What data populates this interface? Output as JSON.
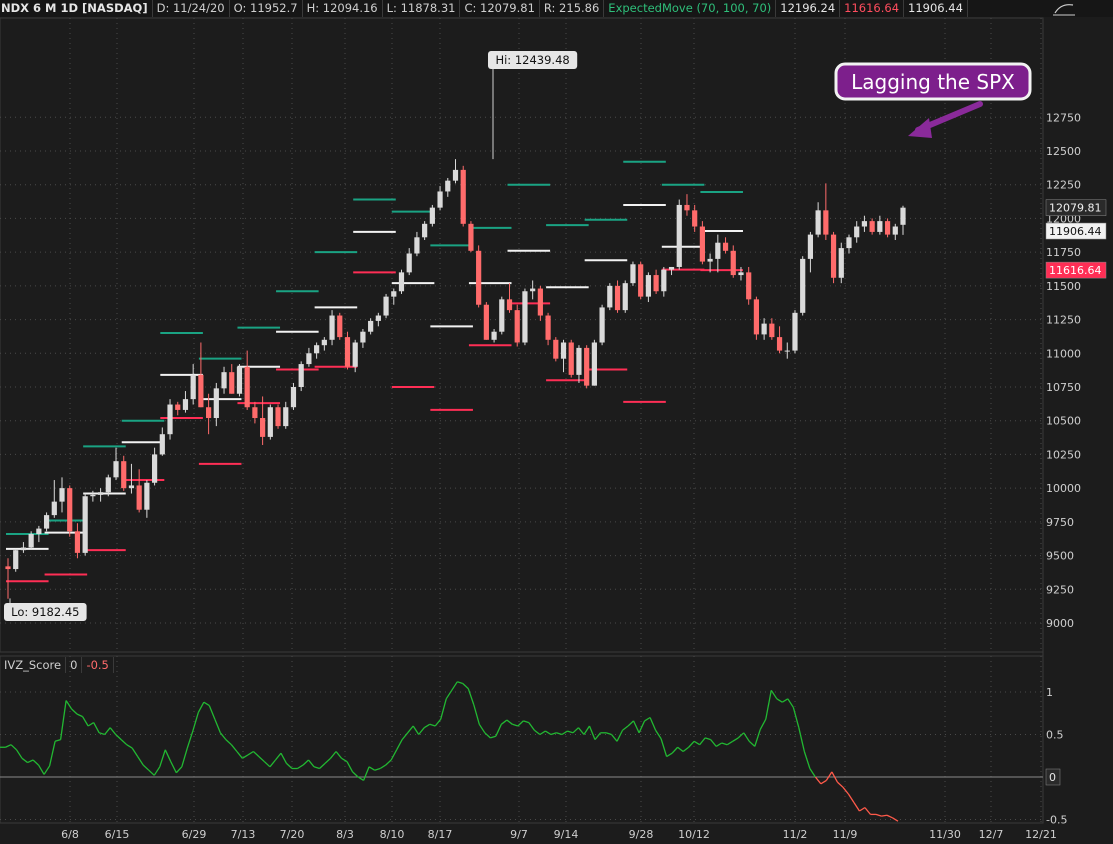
{
  "header": {
    "title": "NDX 6 M 1D [NASDAQ]",
    "date": "D: 11/24/20",
    "open": "O: 11952.7",
    "high": "H: 12094.16",
    "low": "L: 11878.31",
    "close": "C: 12079.81",
    "range": "R: 215.86",
    "study": "ExpectedMove (70, 100, 70)",
    "em_upper": "12196.24",
    "em_lower": "11616.64",
    "em_mid": "11906.44"
  },
  "lower_header": {
    "name": "IVZ_Score",
    "v1": "0",
    "v2": "-0.5"
  },
  "annotation": {
    "text": "Lagging the SPX"
  },
  "colors": {
    "background": "#1c1c1c",
    "up": "#dadada",
    "down": "#ff6b6b",
    "em_upper": "#1aa383",
    "em_lower": "#ff2e55",
    "em_mid": "#f2f2f2",
    "ivz_pos": "#22b832",
    "ivz_neg": "#ff5a4a",
    "annotation": "#7d1f8c"
  },
  "chart_data": [
    {
      "type": "candlestick",
      "title": "NDX 6 M 1D [NASDAQ]",
      "ylim": [
        8850,
        12800
      ],
      "y_ticks": [
        9000,
        9250,
        9500,
        9750,
        10000,
        10250,
        10500,
        10750,
        11000,
        11250,
        11500,
        11750,
        12000,
        12250,
        12500,
        12750
      ],
      "x_ticks": [
        "6/8",
        "6/15",
        "6/29",
        "7/13",
        "7/20",
        "8/3",
        "8/10",
        "8/17",
        "9/7",
        "9/14",
        "9/28",
        "10/12",
        "11/2",
        "11/9",
        "11/30",
        "12/7",
        "12/21"
      ],
      "price_labels": {
        "last": "12079.81",
        "mid": "11906.44",
        "lower": "11616.64"
      },
      "hi_label": {
        "text": "Hi: 12439.48",
        "value": 12439.48
      },
      "lo_label": {
        "text": "Lo: 9182.45",
        "value": 9182.45
      },
      "candles": [
        [
          9420,
          9480,
          9180,
          9400
        ],
        [
          9400,
          9550,
          9380,
          9540
        ],
        [
          9540,
          9600,
          9520,
          9560
        ],
        [
          9560,
          9680,
          9550,
          9660
        ],
        [
          9660,
          9720,
          9600,
          9700
        ],
        [
          9700,
          9820,
          9680,
          9800
        ],
        [
          9800,
          10060,
          9780,
          9900
        ],
        [
          9900,
          10080,
          9820,
          10000
        ],
        [
          10000,
          10020,
          9640,
          9680
        ],
        [
          9680,
          9740,
          9480,
          9520
        ],
        [
          9520,
          9960,
          9500,
          9940
        ],
        [
          9940,
          9980,
          9900,
          9950
        ],
        [
          9950,
          10000,
          9900,
          9970
        ],
        [
          9970,
          10100,
          9940,
          10080
        ],
        [
          10080,
          10300,
          10060,
          10200
        ],
        [
          10200,
          10240,
          9980,
          10000
        ],
        [
          10000,
          10180,
          9960,
          10020
        ],
        [
          10020,
          10140,
          9820,
          9840
        ],
        [
          9840,
          10060,
          9780,
          10040
        ],
        [
          10040,
          10300,
          10020,
          10250
        ],
        [
          10250,
          10450,
          10240,
          10400
        ],
        [
          10400,
          10660,
          10360,
          10620
        ],
        [
          10620,
          10640,
          10540,
          10580
        ],
        [
          10580,
          10720,
          10560,
          10660
        ],
        [
          10660,
          10920,
          10620,
          10840
        ],
        [
          10840,
          11080,
          10600,
          10600
        ],
        [
          10600,
          10700,
          10400,
          10520
        ],
        [
          10520,
          10780,
          10460,
          10740
        ],
        [
          10740,
          10900,
          10700,
          10860
        ],
        [
          10860,
          10920,
          10700,
          10700
        ],
        [
          10700,
          10920,
          10680,
          10900
        ],
        [
          10900,
          11020,
          10580,
          10600
        ],
        [
          10600,
          10640,
          10480,
          10520
        ],
        [
          10520,
          10680,
          10320,
          10380
        ],
        [
          10380,
          10620,
          10360,
          10600
        ],
        [
          10600,
          10620,
          10440,
          10460
        ],
        [
          10460,
          10640,
          10440,
          10600
        ],
        [
          10600,
          10780,
          10580,
          10750
        ],
        [
          10750,
          10940,
          10720,
          10920
        ],
        [
          10920,
          11040,
          10900,
          11000
        ],
        [
          11000,
          11080,
          10960,
          11060
        ],
        [
          11060,
          11120,
          11020,
          11100
        ],
        [
          11100,
          11320,
          11060,
          11280
        ],
        [
          11280,
          11300,
          11100,
          11120
        ],
        [
          11120,
          11160,
          10880,
          10900
        ],
        [
          10900,
          11100,
          10860,
          11080
        ],
        [
          11080,
          11180,
          11040,
          11160
        ],
        [
          11160,
          11260,
          11140,
          11240
        ],
        [
          11240,
          11300,
          11200,
          11280
        ],
        [
          11280,
          11440,
          11260,
          11420
        ],
        [
          11420,
          11480,
          11360,
          11460
        ],
        [
          11460,
          11620,
          11440,
          11600
        ],
        [
          11600,
          11780,
          11580,
          11740
        ],
        [
          11740,
          11900,
          11720,
          11860
        ],
        [
          11860,
          11980,
          11840,
          11960
        ],
        [
          11960,
          12100,
          11940,
          12080
        ],
        [
          12080,
          12240,
          12060,
          12200
        ],
        [
          12200,
          12300,
          12160,
          12280
        ],
        [
          12280,
          12440,
          12260,
          12360
        ],
        [
          12360,
          12390,
          11940,
          11960
        ],
        [
          11960,
          11980,
          11750,
          11760
        ],
        [
          11760,
          11800,
          11340,
          11360
        ],
        [
          11360,
          11380,
          11100,
          11100
        ],
        [
          11100,
          11180,
          11080,
          11160
        ],
        [
          11160,
          11420,
          11140,
          11400
        ],
        [
          11400,
          11520,
          11300,
          11320
        ],
        [
          11320,
          11360,
          11050,
          11080
        ],
        [
          11080,
          11480,
          11060,
          11460
        ],
        [
          11460,
          11540,
          11400,
          11480
        ],
        [
          11480,
          11500,
          11240,
          11280
        ],
        [
          11280,
          11300,
          11060,
          11100
        ],
        [
          11100,
          11120,
          10940,
          10960
        ],
        [
          10960,
          11100,
          10860,
          11080
        ],
        [
          11080,
          11100,
          10820,
          10840
        ],
        [
          10840,
          11060,
          10780,
          11040
        ],
        [
          11040,
          11060,
          10740,
          10760
        ],
        [
          10760,
          11100,
          10760,
          11080
        ],
        [
          11080,
          11360,
          11060,
          11340
        ],
        [
          11340,
          11520,
          11320,
          11500
        ],
        [
          11500,
          11540,
          11300,
          11320
        ],
        [
          11320,
          11540,
          11300,
          11520
        ],
        [
          11520,
          11680,
          11500,
          11660
        ],
        [
          11660,
          11680,
          11400,
          11420
        ],
        [
          11420,
          11600,
          11380,
          11580
        ],
        [
          11580,
          11620,
          11440,
          11460
        ],
        [
          11460,
          11640,
          11420,
          11620
        ],
        [
          11620,
          11640,
          11580,
          11640
        ],
        [
          11640,
          12140,
          11620,
          12100
        ],
        [
          12100,
          12180,
          12020,
          12060
        ],
        [
          12060,
          12100,
          11900,
          11940
        ],
        [
          11940,
          11980,
          11660,
          11680
        ],
        [
          11680,
          11740,
          11600,
          11700
        ],
        [
          11700,
          11880,
          11600,
          11820
        ],
        [
          11820,
          11860,
          11740,
          11760
        ],
        [
          11760,
          11800,
          11560,
          11580
        ],
        [
          11580,
          11640,
          11540,
          11600
        ],
        [
          11600,
          11640,
          11360,
          11400
        ],
        [
          11400,
          11420,
          11100,
          11140
        ],
        [
          11140,
          11260,
          11100,
          11220
        ],
        [
          11220,
          11260,
          11100,
          11120
        ],
        [
          11120,
          11200,
          11000,
          11020
        ],
        [
          11020,
          11080,
          10960,
          11020
        ],
        [
          11020,
          11320,
          11000,
          11300
        ],
        [
          11300,
          11720,
          11280,
          11700
        ],
        [
          11700,
          11900,
          11600,
          11880
        ],
        [
          11880,
          12120,
          11860,
          12060
        ],
        [
          12060,
          12260,
          11840,
          11880
        ],
        [
          11880,
          11900,
          11520,
          11560
        ],
        [
          11560,
          11820,
          11520,
          11780
        ],
        [
          11780,
          11880,
          11740,
          11860
        ],
        [
          11860,
          11980,
          11820,
          11940
        ],
        [
          11940,
          12020,
          11900,
          11980
        ],
        [
          11980,
          12000,
          11880,
          11900
        ],
        [
          11900,
          12020,
          11880,
          11980
        ],
        [
          11980,
          12000,
          11860,
          11880
        ],
        [
          11880,
          11960,
          11840,
          11940
        ],
        [
          11952.7,
          12094.16,
          11878.31,
          12079.81
        ]
      ],
      "expected_move": [
        {
          "from": 0,
          "to": 5,
          "upper": 9660,
          "mid": 9550,
          "lower": 9310
        },
        {
          "from": 5,
          "to": 10,
          "upper": 9760,
          "mid": 9670,
          "lower": 9360
        },
        {
          "from": 10,
          "to": 15,
          "upper": 10310,
          "mid": 9960,
          "lower": 9540
        },
        {
          "from": 15,
          "to": 20,
          "upper": 10500,
          "mid": 10340,
          "lower": 10060
        },
        {
          "from": 20,
          "to": 25,
          "upper": 11150,
          "mid": 10840,
          "lower": 10520
        },
        {
          "from": 25,
          "to": 30,
          "upper": 10960,
          "mid": 10660,
          "lower": 10180
        },
        {
          "from": 30,
          "to": 35,
          "upper": 11190,
          "mid": 10900,
          "lower": 10630
        },
        {
          "from": 35,
          "to": 40,
          "upper": 11460,
          "mid": 11160,
          "lower": 10880
        },
        {
          "from": 40,
          "to": 45,
          "upper": 11750,
          "mid": 11340,
          "lower": 10900
        },
        {
          "from": 45,
          "to": 50,
          "upper": 12140,
          "mid": 11900,
          "lower": 11600
        },
        {
          "from": 50,
          "to": 55,
          "upper": 12050,
          "mid": 11520,
          "lower": 10750
        },
        {
          "from": 55,
          "to": 60,
          "upper": 11800,
          "mid": 11200,
          "lower": 10580
        },
        {
          "from": 60,
          "to": 65,
          "upper": 11930,
          "mid": 11520,
          "lower": 11060
        },
        {
          "from": 65,
          "to": 70,
          "upper": 12250,
          "mid": 11760,
          "lower": 11370
        },
        {
          "from": 70,
          "to": 75,
          "upper": 11950,
          "mid": 11490,
          "lower": 10800
        },
        {
          "from": 75,
          "to": 80,
          "upper": 11990,
          "mid": 11690,
          "lower": 10880
        },
        {
          "from": 80,
          "to": 85,
          "upper": 12420,
          "mid": 12100,
          "lower": 10640
        },
        {
          "from": 85,
          "to": 90,
          "upper": 12250,
          "mid": 11790,
          "lower": 11620
        },
        {
          "from": 90,
          "to": 95,
          "upper": 12196.24,
          "mid": 11906.44,
          "lower": 11616.64
        }
      ]
    },
    {
      "type": "line",
      "title": "IVZ_Score",
      "ylim": [
        -0.58,
        1.33
      ],
      "y_ticks": [
        -0.5,
        0,
        0.5,
        1
      ],
      "baseline": 0,
      "values": [
        0.35,
        0.35,
        0.38,
        0.32,
        0.22,
        0.17,
        0.2,
        0.14,
        0.03,
        0.13,
        0.42,
        0.44,
        0.9,
        0.8,
        0.74,
        0.71,
        0.6,
        0.64,
        0.52,
        0.5,
        0.58,
        0.5,
        0.44,
        0.38,
        0.34,
        0.24,
        0.14,
        0.08,
        0.02,
        0.12,
        0.32,
        0.18,
        0.05,
        0.12,
        0.34,
        0.54,
        0.76,
        0.88,
        0.84,
        0.68,
        0.52,
        0.44,
        0.38,
        0.3,
        0.22,
        0.26,
        0.3,
        0.24,
        0.18,
        0.12,
        0.2,
        0.28,
        0.16,
        0.1,
        0.1,
        0.14,
        0.2,
        0.12,
        0.1,
        0.16,
        0.22,
        0.3,
        0.22,
        0.18,
        0.06,
        0.0,
        -0.04,
        0.12,
        0.08,
        0.1,
        0.14,
        0.2,
        0.32,
        0.44,
        0.52,
        0.6,
        0.5,
        0.58,
        0.62,
        0.6,
        0.68,
        0.92,
        1.02,
        1.12,
        1.1,
        1.04,
        0.85,
        0.62,
        0.52,
        0.46,
        0.48,
        0.62,
        0.67,
        0.62,
        0.6,
        0.66,
        0.64,
        0.55,
        0.5,
        0.54,
        0.5,
        0.52,
        0.5,
        0.54,
        0.52,
        0.58,
        0.5,
        0.6,
        0.44,
        0.52,
        0.52,
        0.5,
        0.42,
        0.55,
        0.6,
        0.66,
        0.52,
        0.66,
        0.7,
        0.55,
        0.45,
        0.24,
        0.28,
        0.35,
        0.3,
        0.35,
        0.42,
        0.38,
        0.46,
        0.44,
        0.36,
        0.4,
        0.38,
        0.42,
        0.46,
        0.52,
        0.42,
        0.36,
        0.56,
        0.68,
        1.02,
        0.92,
        0.88,
        0.92,
        0.82,
        0.58,
        0.3,
        0.1,
        0.0,
        -0.08,
        -0.04,
        0.06,
        -0.06,
        -0.12,
        -0.2,
        -0.3,
        -0.4,
        -0.36,
        -0.44,
        -0.44,
        -0.46,
        -0.45,
        -0.48,
        -0.52
      ]
    }
  ]
}
